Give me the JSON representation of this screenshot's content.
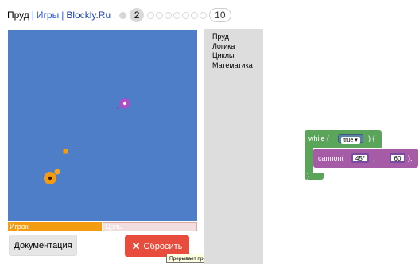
{
  "header": {
    "title": "Пруд",
    "separator": "|",
    "games_link": "Игры",
    "site_link": "Blockly.Ru",
    "levels": {
      "completed_dots": 1,
      "current": "2",
      "upcoming_dots": 7,
      "last": "10"
    }
  },
  "game": {
    "background_color": "#4f7ec8",
    "player_bar_label": "Игрок",
    "goal_bar_label": "Цель",
    "player_color": "#f39c12",
    "enemy_color": "#b14bc7"
  },
  "buttons": {
    "docs_label": "Документация",
    "reset_label": "Сбросить",
    "reset_icon": "✕"
  },
  "tooltip": "Прерывает программу и сбрасывает в начальное \\nсостояние.",
  "toolbox": {
    "categories": [
      "Пруд",
      "Логика",
      "Циклы",
      "Математика"
    ]
  },
  "blocks": {
    "while_label": "while (",
    "while_close": ") {",
    "while_end": "}",
    "bool_value": "true",
    "cannon_label": "cannon(",
    "cannon_sep": ",",
    "cannon_close": ");",
    "angle": "45°",
    "range": "60"
  }
}
